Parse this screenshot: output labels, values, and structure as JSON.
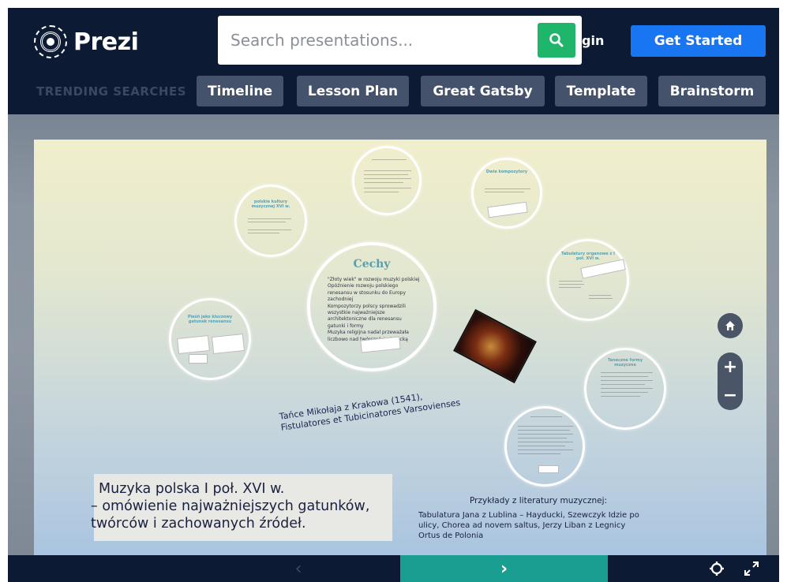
{
  "brand": {
    "name": "Prezi"
  },
  "search": {
    "placeholder": "Search presentations..."
  },
  "header": {
    "login_label": "gin",
    "get_started_label": "Get Started"
  },
  "trending": {
    "label": "TRENDING SEARCHES",
    "chips": [
      "Timeline",
      "Lesson Plan",
      "Great Gatsby",
      "Template",
      "Brainstorm"
    ]
  },
  "presentation": {
    "main_circle": {
      "title": "Cechy",
      "bullets": [
        "\"Złoty wiek\" w rozwoju muzyki polskiej",
        "Opóźnienie rozwoju polskiego renesansu w stosunku do Europy zachodniej",
        "Kompozytorzy polscy sprowadzili wszystkie najważniejsze architektoniczne dla renesansu gatunki i formy",
        "Muzyka religijna nadal przeważała liczbowo nad twórczością świecką"
      ]
    },
    "circles": [
      {
        "title": "polskie kultury muzycznej XVI w."
      },
      {
        "title": "Pieśń jako kluczowy gatunek renesansu"
      },
      {
        "title": "Dwie kompozytory"
      },
      {
        "title": "Tabulatury organowe z I poł. XVI w."
      },
      {
        "title": "Taneczne formy muzyczne"
      }
    ],
    "caption": [
      "Tańce Mikołaja z Krakowa (1541),",
      "Fistulatores et Tubicinatores Varsovienses"
    ],
    "title_lines": [
      "Muzyka polska I poł. XVI w.",
      "– omówienie najważniejszych gatunków,",
      "twórców i zachowanych źródeł."
    ],
    "examples": {
      "heading": "Przykłady z literatury muzycznej:",
      "text": "Tabulatura Jana z Lublina – Hayducki, Szewczyk Idzie po ulicy, Chorea ad novem saltus, Jerzy Liban z Legnicy Ortus de Polonia"
    }
  },
  "controls": {
    "zoom_in": "+",
    "zoom_out": "−",
    "prev": "‹",
    "next": "›"
  },
  "colors": {
    "header_bg": "#0d1a33",
    "search_button": "#1fb56b",
    "get_started": "#1976f2",
    "chip_bg": "#44526b",
    "next_button": "#1a9e91",
    "accent_text": "#5a9fae"
  },
  "icons": [
    "prezi-logo-icon",
    "search-icon",
    "home-icon",
    "settings-icon",
    "fullscreen-icon"
  ]
}
